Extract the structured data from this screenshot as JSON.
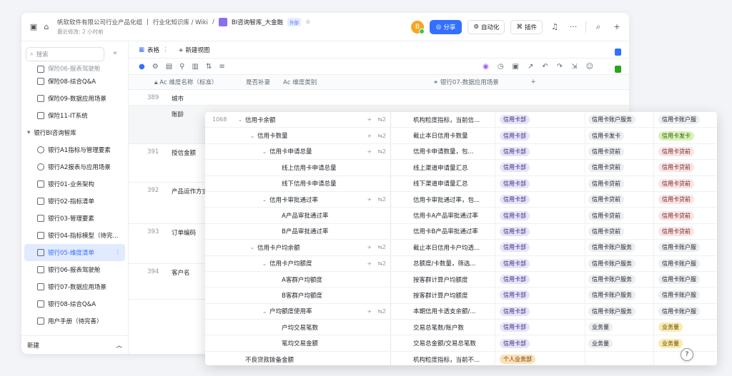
{
  "header": {
    "path": "帆软软件有限公司行业产品化组",
    "path2": "行业化知识库 / Wiki",
    "doc_title": "BI咨询智库_大金融",
    "ext_badge": "外部",
    "last_edit": "最近修改: 2 小时前",
    "avatar_letter": "B",
    "share": "分享",
    "automation": "自动化",
    "plugin": "插件",
    "more": "···"
  },
  "sidebar": {
    "search_placeholder": "搜索",
    "items": [
      {
        "label": "保险06-报表驾驶舱",
        "type": "table",
        "cut": true
      },
      {
        "label": "保险08-综合Q&A",
        "type": "table"
      },
      {
        "label": "保险09-数据应用场景",
        "type": "table"
      },
      {
        "label": "保险11-IT系统",
        "type": "table"
      },
      {
        "label": "银行BI咨询智库",
        "type": "group"
      },
      {
        "label": "银行A1指标与管理要素",
        "type": "clock"
      },
      {
        "label": "银行A2报表与应用场景",
        "type": "clock"
      },
      {
        "label": "银行01-业务架构",
        "type": "table"
      },
      {
        "label": "银行02-指标清单",
        "type": "table"
      },
      {
        "label": "银行03-管理要素",
        "type": "table"
      },
      {
        "label": "银行04-指标模型（待完...",
        "type": "table"
      },
      {
        "label": "银行05-维度清单",
        "type": "table",
        "active": true
      },
      {
        "label": "银行06-报表驾驶舱",
        "type": "table"
      },
      {
        "label": "银行07-数据应用场景",
        "type": "table"
      },
      {
        "label": "银行08-综合Q&A",
        "type": "table"
      },
      {
        "label": "用户手册（待完善）",
        "type": "doc"
      }
    ],
    "footer": "新建"
  },
  "view": {
    "tab": "表格",
    "new_view": "新建视图",
    "columns": [
      "维度名称（标准）",
      "是否补录",
      "维度类别",
      "银行07-数据应用场景"
    ],
    "rows": [
      {
        "num": "389",
        "name": "城市"
      },
      {
        "num": "",
        "name": "账龄"
      },
      {
        "num": "391",
        "name": "授信金额"
      },
      {
        "num": "392",
        "name": "产品运作方式"
      },
      {
        "num": "393",
        "name": "订单编码"
      },
      {
        "num": "394",
        "name": "客户名"
      }
    ]
  },
  "front_rows": [
    {
      "id": "1068",
      "level": 0,
      "chev": true,
      "name": "信用卡余额",
      "acts": true,
      "desc": "机构粒度指标，当前信...",
      "dept": "信用卡部",
      "cat": "信用卡账户服务",
      "cat_c": "gray",
      "app": "信用卡账户服",
      "app_c": "gray"
    },
    {
      "id": "",
      "level": 1,
      "chev": true,
      "name": "信用卡数量",
      "acts": true,
      "desc": "截止本日信用卡数量",
      "dept": "信用卡部",
      "cat": "信用卡发卡",
      "cat_c": "gray",
      "app": "信用卡发卡",
      "app_c": "green"
    },
    {
      "id": "",
      "level": 2,
      "chev": true,
      "name": "信用卡申请总量",
      "acts": true,
      "desc": "信用卡申请数量，包...",
      "dept": "信用卡部",
      "cat": "信用卡贷前",
      "cat_c": "gray",
      "app": "信用卡贷前",
      "app_c": "pink"
    },
    {
      "id": "",
      "level": 3,
      "chev": false,
      "name": "线上信用卡申请总量",
      "acts": false,
      "desc": "线上渠道申请量汇总",
      "dept": "信用卡部",
      "cat": "信用卡贷前",
      "cat_c": "gray",
      "app": "信用卡贷前",
      "app_c": "pink"
    },
    {
      "id": "",
      "level": 3,
      "chev": false,
      "name": "线下信用卡申请总量",
      "acts": false,
      "desc": "线下渠道申请量汇总",
      "dept": "信用卡部",
      "cat": "信用卡贷前",
      "cat_c": "gray",
      "app": "信用卡贷前",
      "app_c": "pink"
    },
    {
      "id": "",
      "level": 2,
      "chev": true,
      "name": "信用卡审批通过率",
      "acts": true,
      "desc": "信用卡审批通过率，包...",
      "dept": "信用卡部",
      "cat": "信用卡贷前",
      "cat_c": "gray",
      "app": "信用卡贷前",
      "app_c": "pink"
    },
    {
      "id": "",
      "level": 3,
      "chev": false,
      "name": "A产品审批通过率",
      "acts": false,
      "desc": "信用卡A产品审批通过率",
      "dept": "信用卡部",
      "cat": "信用卡贷前",
      "cat_c": "gray",
      "app": "信用卡贷前",
      "app_c": "pink"
    },
    {
      "id": "",
      "level": 3,
      "chev": false,
      "name": "B产品审批通过率",
      "acts": false,
      "desc": "信用卡B产品审批通过率",
      "dept": "信用卡部",
      "cat": "信用卡贷前",
      "cat_c": "gray",
      "app": "信用卡贷前",
      "app_c": "pink"
    },
    {
      "id": "",
      "level": 1,
      "chev": true,
      "name": "信用卡户均余额",
      "acts": true,
      "desc": "截止本日信用卡户均透...",
      "dept": "信用卡部",
      "cat": "信用卡账户服务",
      "cat_c": "gray",
      "app": "信用卡账户服",
      "app_c": "gray"
    },
    {
      "id": "",
      "level": 2,
      "chev": true,
      "name": "信用卡户均额度",
      "acts": true,
      "desc": "总额度/卡数量，筛选...",
      "dept": "信用卡部",
      "cat": "信用卡账户服务",
      "cat_c": "gray",
      "app": "信用卡账户服",
      "app_c": "gray"
    },
    {
      "id": "",
      "level": 3,
      "chev": false,
      "name": "A客群户均额度",
      "acts": false,
      "desc": "按客群计算户均额度",
      "dept": "信用卡部",
      "cat": "信用卡账户服务",
      "cat_c": "gray",
      "app": "信用卡账户服",
      "app_c": "gray"
    },
    {
      "id": "",
      "level": 3,
      "chev": false,
      "name": "B客群户均额度",
      "acts": false,
      "desc": "按客群计算户均额度",
      "dept": "信用卡部",
      "cat": "信用卡账户服务",
      "cat_c": "gray",
      "app": "信用卡账户服",
      "app_c": "gray"
    },
    {
      "id": "",
      "level": 2,
      "chev": true,
      "name": "户均额度使用率",
      "acts": true,
      "desc": "本期信用卡透支余额/...",
      "dept": "信用卡部",
      "cat": "信用卡账户服务",
      "cat_c": "gray",
      "app": "信用卡账户服",
      "app_c": "gray"
    },
    {
      "id": "",
      "level": 3,
      "chev": false,
      "name": "户均交易笔数",
      "acts": false,
      "desc": "交易总笔数/账户数",
      "dept": "信用卡部",
      "cat": "业务量",
      "cat_c": "gray",
      "app": "业务量",
      "app_c": "yellow"
    },
    {
      "id": "",
      "level": 3,
      "chev": false,
      "name": "笔均交易金额",
      "acts": false,
      "desc": "交易总金额/交易总笔数",
      "dept": "信用卡部",
      "cat": "业务量",
      "cat_c": "gray",
      "app": "业务量",
      "app_c": "yellow"
    },
    {
      "id": "",
      "level": 0,
      "chev": false,
      "name": "不良贷款拨备金额",
      "acts": false,
      "desc": "机构粒度指标，当前不...",
      "dept": "个人业务部",
      "cat": "",
      "cat_c": "gray",
      "app": "",
      "app_c": "gray",
      "dept_c": "orange"
    }
  ],
  "colors": {
    "accent": "#3370ff",
    "active_bg": "#e1eaff"
  }
}
